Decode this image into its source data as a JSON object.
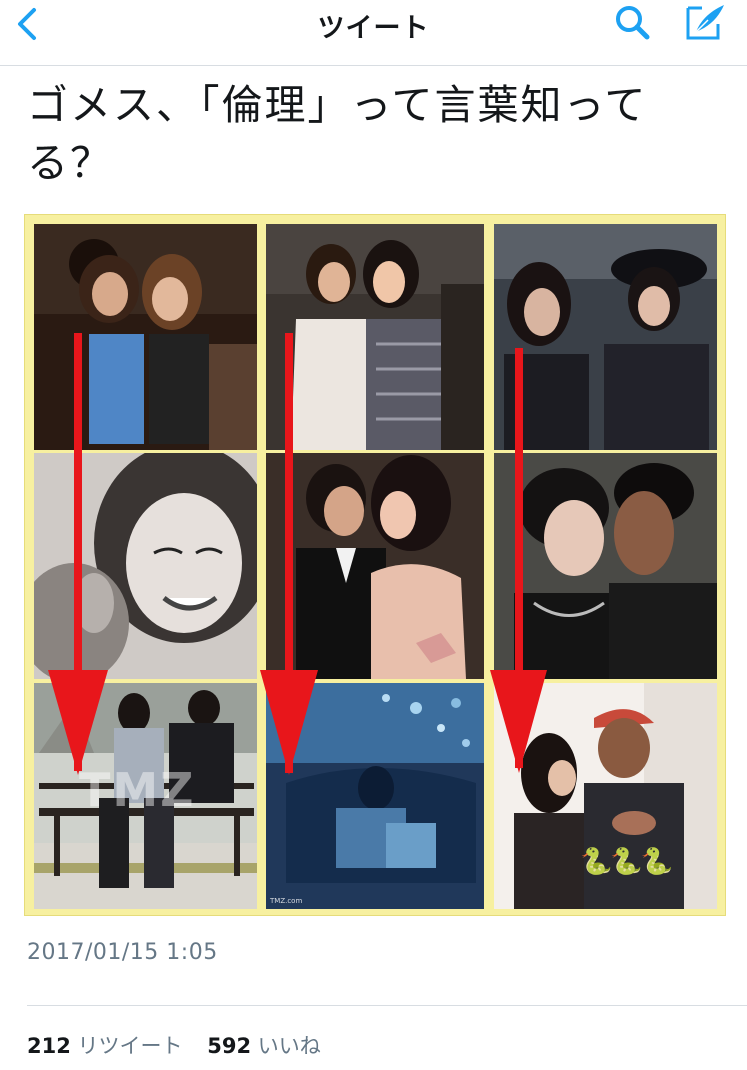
{
  "nav": {
    "title": "ツイート",
    "back_icon": "chevron-left-icon",
    "search_icon": "search-icon",
    "compose_icon": "compose-icon",
    "accent_color": "#1da1f2"
  },
  "tweet": {
    "text": "ゴメス、「倫理」って言葉知ってる？",
    "timestamp": "2017/01/15 1:05",
    "retweet_count": "212",
    "retweet_label": "リツイート",
    "like_count": "592",
    "like_label": "いいね"
  },
  "media": {
    "background_color": "#f7f0a0",
    "arrow_color": "#e8161b",
    "watermark": "TMZ",
    "small_credit": "TMZ.com",
    "emoji": "🐍🐍🐍"
  }
}
